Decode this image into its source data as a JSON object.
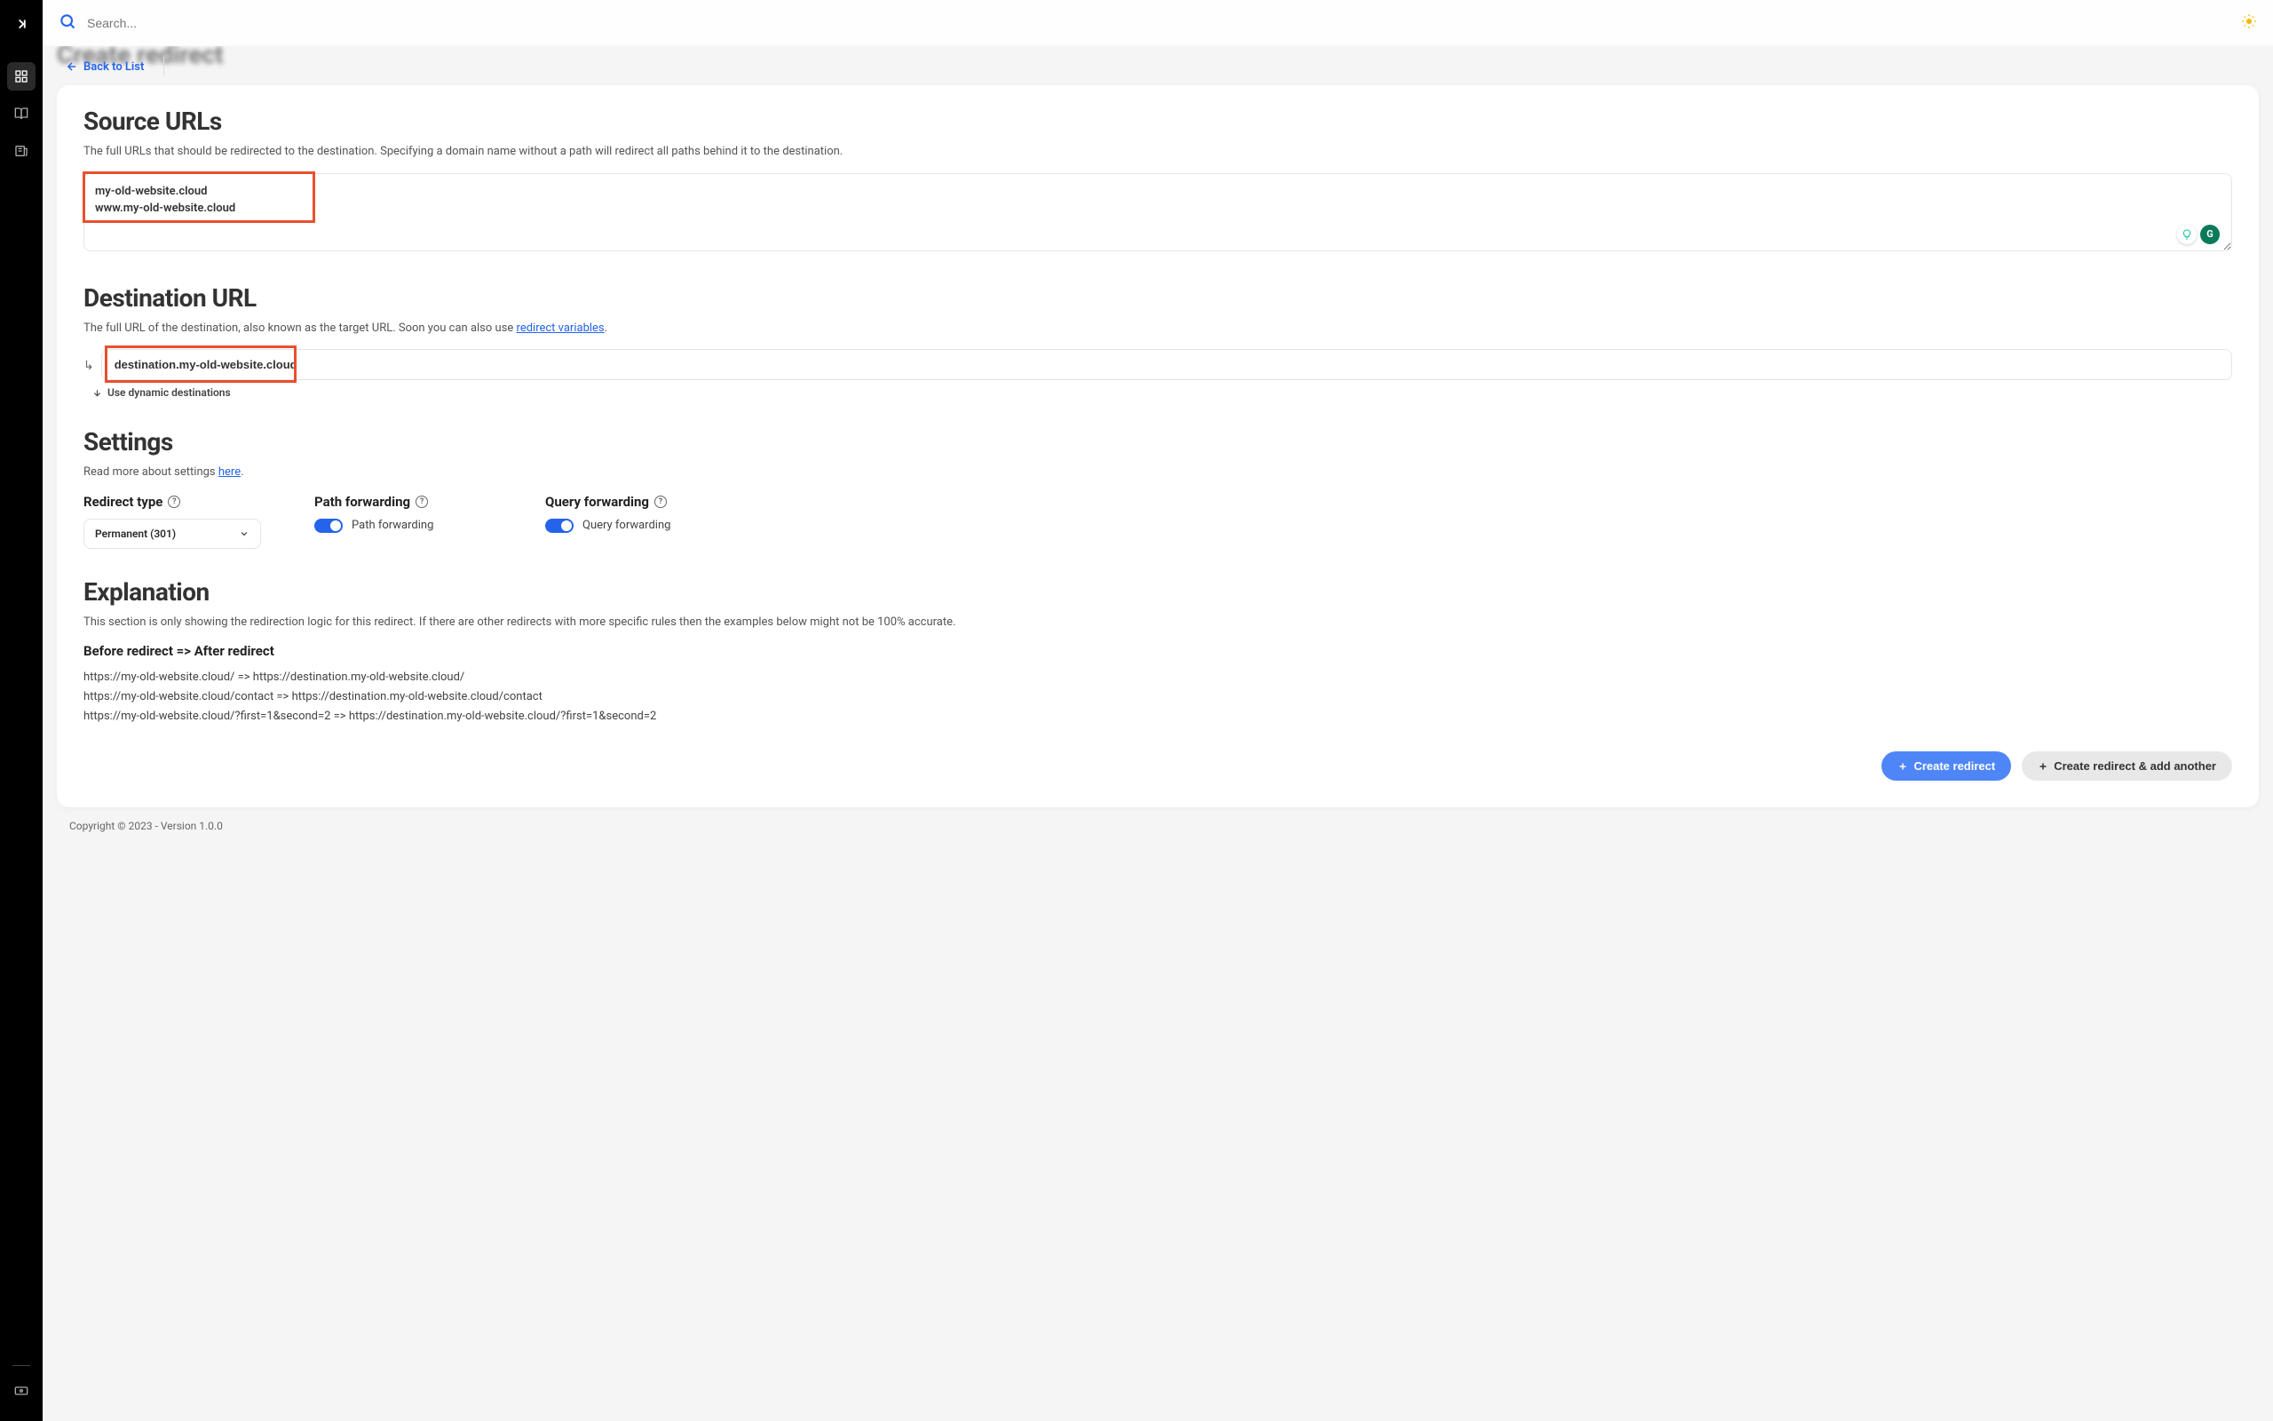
{
  "search": {
    "placeholder": "Search..."
  },
  "page_title_blurred": "Create redirect",
  "back_link": "Back to List",
  "sections": {
    "source": {
      "title": "Source URLs",
      "desc": "The full URLs that should be redirected to the destination. Specifying a domain name without a path will redirect all paths behind it to the destination.",
      "value": "my-old-website.cloud\nwww.my-old-website.cloud"
    },
    "destination": {
      "title": "Destination URL",
      "desc_pre": "The full URL of the destination, also known as the target URL. Soon you can also use ",
      "desc_link": "redirect variables",
      "desc_post": ".",
      "value": "destination.my-old-website.cloud",
      "dynamic": "Use dynamic destinations"
    },
    "settings": {
      "title": "Settings",
      "desc_pre": "Read more about settings ",
      "desc_link": "here",
      "desc_post": ".",
      "redirect_type": {
        "label": "Redirect type",
        "value": "Permanent (301)"
      },
      "path_forwarding": {
        "label": "Path forwarding",
        "toggle_label": "Path forwarding"
      },
      "query_forwarding": {
        "label": "Query forwarding",
        "toggle_label": "Query forwarding"
      }
    },
    "explanation": {
      "title": "Explanation",
      "desc": "This section is only showing the redirection logic for this redirect. If there are other redirects with more specific rules then the examples below might not be 100% accurate.",
      "before_after": "Before redirect => After redirect",
      "examples": [
        "https://my-old-website.cloud/ => https://destination.my-old-website.cloud/",
        "https://my-old-website.cloud/contact => https://destination.my-old-website.cloud/contact",
        "https://my-old-website.cloud/?first=1&second=2 => https://destination.my-old-website.cloud/?first=1&second=2"
      ]
    }
  },
  "buttons": {
    "create": "Create redirect",
    "create_another": "Create redirect & add another"
  },
  "footer": "Copyright © 2023 - Version 1.0.0"
}
